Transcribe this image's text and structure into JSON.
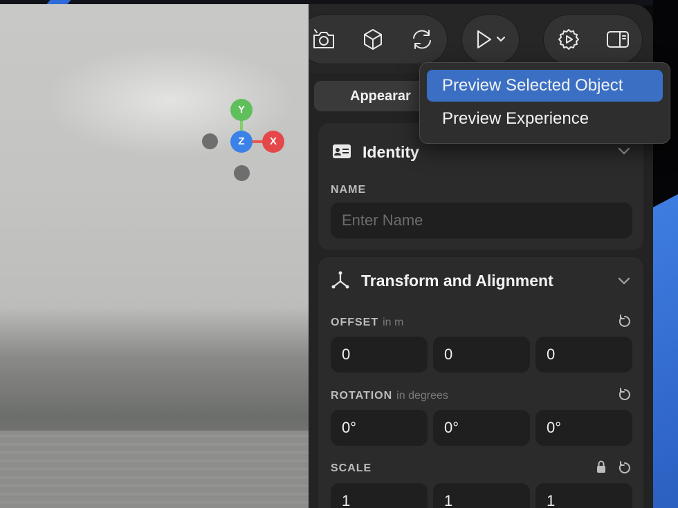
{
  "viewport": {
    "gizmo": {
      "y_label": "Y",
      "z_label": "Z",
      "x_label": "X"
    }
  },
  "toolbar": {
    "icons": [
      "camera-icon",
      "cube-icon",
      "sync-icon",
      "play-icon",
      "chevron-down-icon",
      "gear-icon",
      "sidebar-icon"
    ]
  },
  "tabs": {
    "active": "Appearar"
  },
  "preview_menu": {
    "items": [
      {
        "label": "Preview Selected Object",
        "selected": true
      },
      {
        "label": "Preview Experience",
        "selected": false
      }
    ],
    "highlight_color": "#3a6fc4"
  },
  "identity": {
    "title": "Identity",
    "name_label": "NAME",
    "name_placeholder": "Enter Name",
    "name_value": ""
  },
  "transform": {
    "title": "Transform and Alignment",
    "offset": {
      "label": "OFFSET",
      "unit": "in m",
      "values": [
        "0",
        "0",
        "0"
      ]
    },
    "rotation": {
      "label": "ROTATION",
      "unit": "in degrees",
      "values": [
        "0°",
        "0°",
        "0°"
      ]
    },
    "scale": {
      "label": "SCALE",
      "locked": true,
      "values": [
        "1",
        "1",
        "1"
      ]
    }
  },
  "colors": {
    "panel_bg": "#232323",
    "card_bg": "#2b2b2b",
    "field_bg": "#1f1f1f",
    "gizmo_x": "#e4484a",
    "gizmo_y": "#5fbf5a",
    "gizmo_z": "#3b82e8"
  }
}
